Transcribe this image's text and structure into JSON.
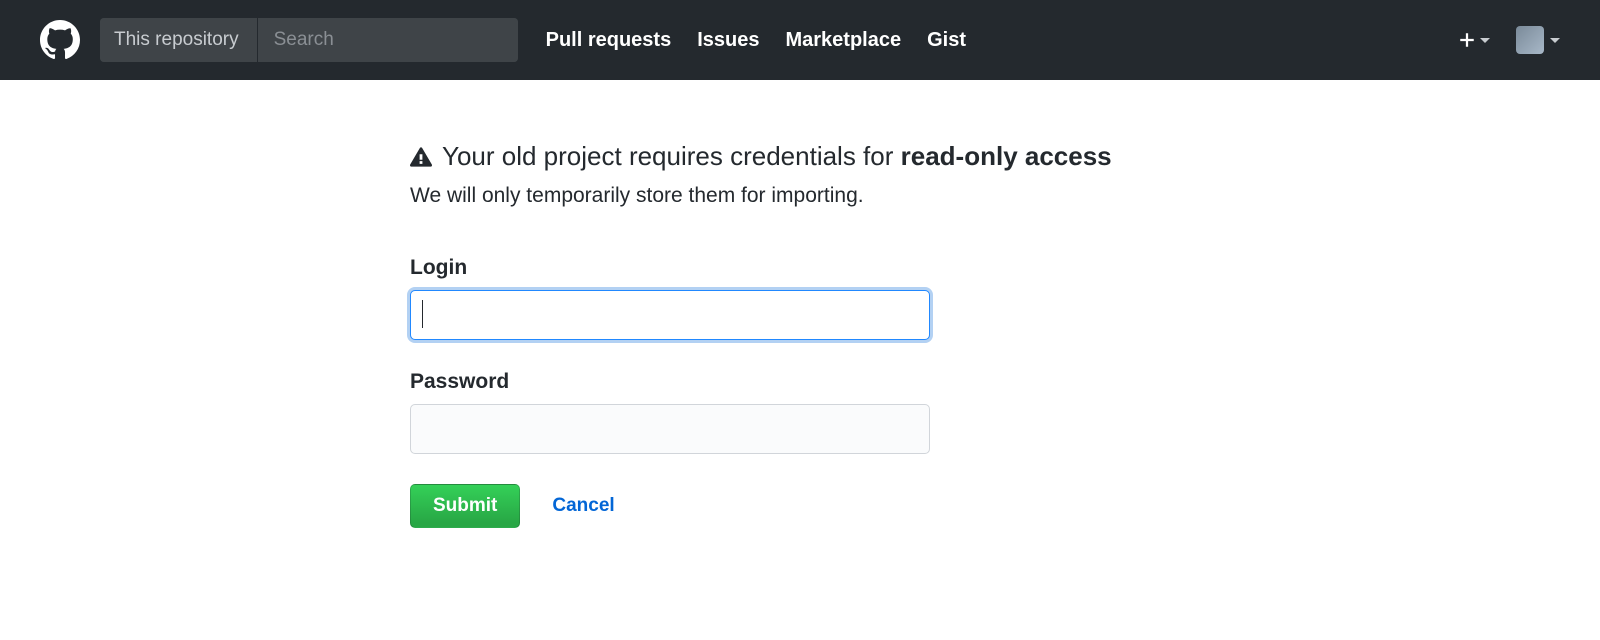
{
  "header": {
    "search_scope": "This repository",
    "search_placeholder": "Search",
    "nav": {
      "pull_requests": "Pull requests",
      "issues": "Issues",
      "marketplace": "Marketplace",
      "gist": "Gist"
    }
  },
  "main": {
    "title_a": "Your old project requires credentials for ",
    "title_b": "read-only access",
    "subtitle": "We will only temporarily store them for importing.",
    "login_label": "Login",
    "login_value": "",
    "password_label": "Password",
    "password_value": "",
    "submit_label": "Submit",
    "cancel_label": "Cancel"
  }
}
